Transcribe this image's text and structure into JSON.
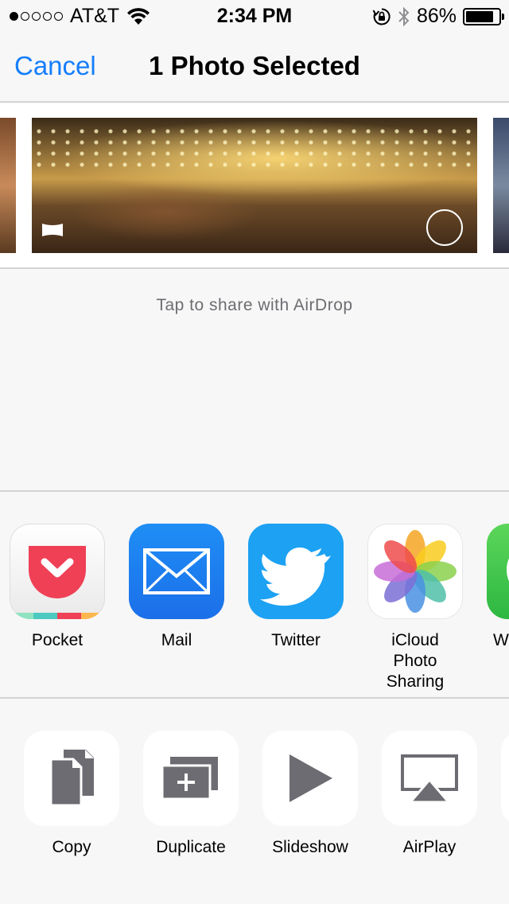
{
  "status_bar": {
    "carrier": "AT&T",
    "signal_bars_filled": 1,
    "signal_bars_total": 5,
    "time": "2:34 PM",
    "battery_percent": "86%",
    "battery_level": 0.86,
    "icons": [
      "wifi-icon",
      "orientation-lock-icon",
      "bluetooth-icon",
      "battery-icon"
    ]
  },
  "nav": {
    "cancel_label": "Cancel",
    "title": "1 Photo Selected"
  },
  "airdrop_hint": "Tap to share with AirDrop",
  "share_apps": [
    {
      "label": "Pocket",
      "icon": "pocket-icon"
    },
    {
      "label": "Mail",
      "icon": "mail-icon"
    },
    {
      "label": "Twitter",
      "icon": "twitter-icon"
    },
    {
      "label": "iCloud Photo Sharing",
      "icon": "photos-icon"
    },
    {
      "label": "W",
      "icon": "whatsapp-icon"
    }
  ],
  "actions": [
    {
      "label": "Copy",
      "icon": "copy-icon"
    },
    {
      "label": "Duplicate",
      "icon": "duplicate-icon"
    },
    {
      "label": "Slideshow",
      "icon": "slideshow-icon"
    },
    {
      "label": "AirPlay",
      "icon": "airplay-icon"
    }
  ],
  "colors": {
    "accent": "#157efb",
    "icon_gray": "#6c6c72"
  }
}
